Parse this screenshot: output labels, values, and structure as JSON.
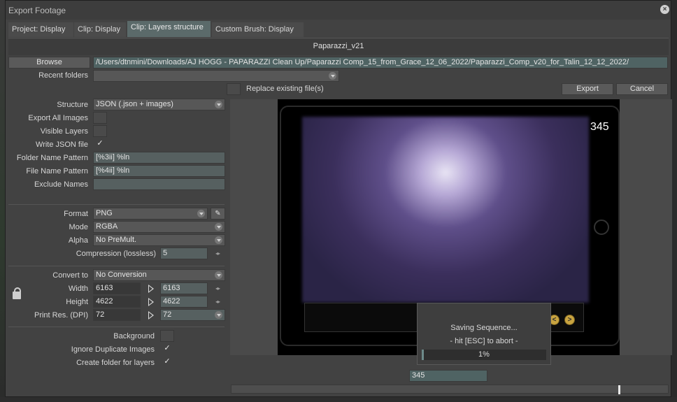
{
  "window": {
    "title": "Export Footage"
  },
  "tabs": [
    {
      "label": "Project: Display"
    },
    {
      "label": "Clip: Display"
    },
    {
      "label": "Clip: Layers structure"
    },
    {
      "label": "Custom Brush: Display"
    }
  ],
  "project_name": "Paparazzi_v21",
  "path": {
    "browse_label": "Browse",
    "value": "/Users/dtnmini/Downloads/AJ HOGG - PAPARAZZI Clean Up/Paparazzi Comp_15_from_Grace_12_06_2022/Paparazzi_Comp_v20_for_Talin_12_12_2022/",
    "recent_label": "Recent folders",
    "recent_value": "",
    "replace_label": "Replace existing file(s)",
    "export_label": "Export",
    "cancel_label": "Cancel"
  },
  "settings": {
    "structure": {
      "label": "Structure",
      "value": "JSON (.json + images)"
    },
    "export_all_images": {
      "label": "Export All Images",
      "checked": false
    },
    "visible_layers": {
      "label": "Visible Layers",
      "checked": false
    },
    "write_json": {
      "label": "Write JSON file",
      "checked": true,
      "mark": "✓"
    },
    "folder_pattern": {
      "label": "Folder Name Pattern",
      "value": "[%3ii] %ln"
    },
    "file_pattern": {
      "label": "File Name Pattern",
      "value": "[%4ii] %ln"
    },
    "exclude_names": {
      "label": "Exclude Names",
      "value": ""
    },
    "format": {
      "label": "Format",
      "value": "PNG"
    },
    "mode": {
      "label": "Mode",
      "value": "RGBA"
    },
    "alpha": {
      "label": "Alpha",
      "value": "No PreMult."
    },
    "compression": {
      "label": "Compression (lossless)",
      "value": "5"
    },
    "convert_to": {
      "label": "Convert to",
      "value": "No Conversion"
    },
    "width": {
      "label": "Width",
      "source": "6163",
      "target": "6163"
    },
    "height": {
      "label": "Height",
      "source": "4622",
      "target": "4622"
    },
    "print_res": {
      "label": "Print Res. (DPI)",
      "source": "72",
      "target": "72"
    },
    "background": {
      "label": "Background"
    },
    "ignore_duplicates": {
      "label": "Ignore Duplicate Images",
      "checked": true,
      "mark": "✓"
    },
    "create_folder": {
      "label": "Create folder for layers",
      "checked": true,
      "mark": "✓"
    }
  },
  "preview": {
    "frame_number": "345",
    "prev_glyph": "<",
    "next_glyph": ">"
  },
  "progress": {
    "title": "Saving Sequence...",
    "hint": "- hit [ESC] to abort -",
    "percent_text": "1%",
    "fraction": 0.01
  },
  "timeline": {
    "frame_value": "345",
    "position_fraction": 0.89
  },
  "colors": {
    "accent_field": "#566060",
    "progress_fill": "#6d8a8a"
  }
}
